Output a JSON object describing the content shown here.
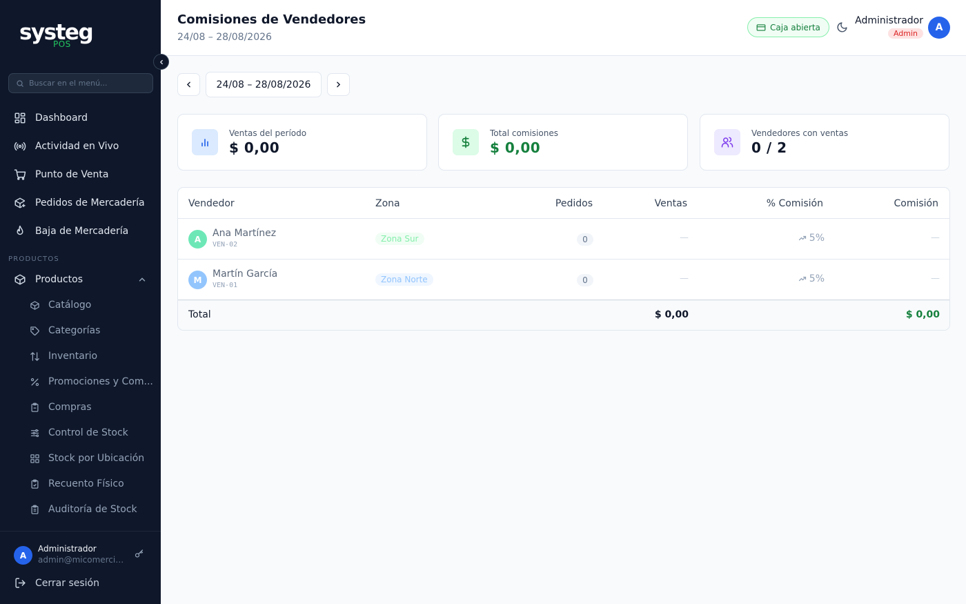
{
  "sidebar": {
    "logo_main": "systeg",
    "logo_sub": "POS",
    "search_placeholder": "Buscar en el menú...",
    "main_items": [
      {
        "label": "Dashboard",
        "icon": "dashboard-grid-icon"
      },
      {
        "label": "Actividad en Vivo",
        "icon": "broadcast-icon"
      },
      {
        "label": "Punto de Venta",
        "icon": "shopping-cart-icon"
      },
      {
        "label": "Pedidos de Mercadería",
        "icon": "package-plus-icon"
      },
      {
        "label": "Baja de Mercadería",
        "icon": "flame-icon"
      }
    ],
    "section_label": "PRODUCTOS",
    "group_label": "Productos",
    "sub_items": [
      {
        "label": "Catálogo",
        "icon": "box-icon"
      },
      {
        "label": "Categorías",
        "icon": "tag-icon"
      },
      {
        "label": "Inventario",
        "icon": "arrows-updown-icon"
      },
      {
        "label": "Promociones y Com...",
        "icon": "percent-icon"
      },
      {
        "label": "Compras",
        "icon": "clipboard-icon"
      },
      {
        "label": "Control de Stock",
        "icon": "sliders-icon"
      },
      {
        "label": "Stock por Ubicación",
        "icon": "grid-icon"
      },
      {
        "label": "Recuento Físico",
        "icon": "clipboard-check-icon"
      },
      {
        "label": "Auditoría de Stock",
        "icon": "clipboard-list-icon"
      }
    ],
    "user": {
      "initial": "A",
      "name": "Administrador",
      "email": "admin@micomercio.com"
    },
    "logout_label": "Cerrar sesión"
  },
  "header": {
    "title": "Comisiones de Vendedores",
    "subtitle": "24/08 – 28/08/2026",
    "caja_label": "Caja abierta",
    "user_name": "Administrador",
    "user_role": "Admin",
    "user_initial": "A"
  },
  "date_nav": {
    "range": "24/08 – 28/08/2026"
  },
  "stats": [
    {
      "label": "Ventas del período",
      "value": "$ 0,00",
      "icon": "bar-chart-icon",
      "color": "#2563eb"
    },
    {
      "label": "Total comisiones",
      "value": "$ 0,00",
      "icon": "dollar-icon",
      "color": "#15803d"
    },
    {
      "label": "Vendedores con ventas",
      "value": "0 / 2",
      "icon": "users-icon",
      "color": "#7c3aed"
    }
  ],
  "table": {
    "headers": {
      "vendedor": "Vendedor",
      "zona": "Zona",
      "pedidos": "Pedidos",
      "ventas": "Ventas",
      "pct": "% Comisión",
      "comision": "Comisión"
    },
    "rows": [
      {
        "initial": "A",
        "name": "Ana Martínez",
        "code": "VEN-02",
        "zona": "Zona Sur",
        "pedidos": "0",
        "ventas": "—",
        "pct": "5%",
        "comision": "—",
        "avatar_color": "#34d399"
      },
      {
        "initial": "M",
        "name": "Martín García",
        "code": "VEN-01",
        "zona": "Zona Norte",
        "pedidos": "0",
        "ventas": "—",
        "pct": "5%",
        "comision": "—",
        "avatar_color": "#60a5fa"
      }
    ],
    "total_label": "Total",
    "total_ventas": "$ 0,00",
    "total_comision": "$ 0,00"
  }
}
